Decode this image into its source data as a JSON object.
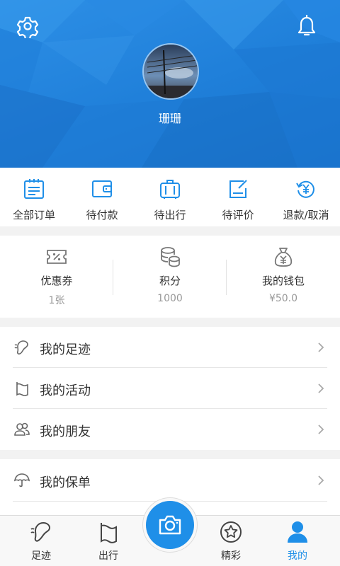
{
  "colors": {
    "primary": "#1f8fe8",
    "header_bg": "#2187e0",
    "text": "#333333",
    "muted": "#999999"
  },
  "header": {
    "username": "珊珊",
    "settings_icon": "gear-icon",
    "bell_icon": "bell-icon"
  },
  "orders": [
    {
      "label": "全部订单",
      "icon": "order-list-icon"
    },
    {
      "label": "待付款",
      "icon": "wallet-icon"
    },
    {
      "label": "待出行",
      "icon": "luggage-icon"
    },
    {
      "label": "待评价",
      "icon": "review-icon"
    },
    {
      "label": "退款/取消",
      "icon": "refund-icon"
    }
  ],
  "assets": [
    {
      "title": "优惠券",
      "value": "1张",
      "icon": "coupon-icon"
    },
    {
      "title": "积分",
      "value": "1000",
      "icon": "coins-icon"
    },
    {
      "title": "我的钱包",
      "value": "¥50.0",
      "icon": "money-bag-icon"
    }
  ],
  "menu": [
    {
      "label": "我的足迹",
      "icon": "footprint-icon"
    },
    {
      "label": "我的活动",
      "icon": "flag-icon"
    },
    {
      "label": "我的朋友",
      "icon": "friends-icon"
    },
    {
      "label": "我的保单",
      "icon": "umbrella-icon"
    }
  ],
  "tabbar": [
    {
      "label": "足迹",
      "icon": "footprint-icon"
    },
    {
      "label": "出行",
      "icon": "flag-icon"
    },
    {
      "label": "",
      "icon": "camera-icon"
    },
    {
      "label": "精彩",
      "icon": "star-icon"
    },
    {
      "label": "我的",
      "icon": "person-icon",
      "active": true
    }
  ]
}
